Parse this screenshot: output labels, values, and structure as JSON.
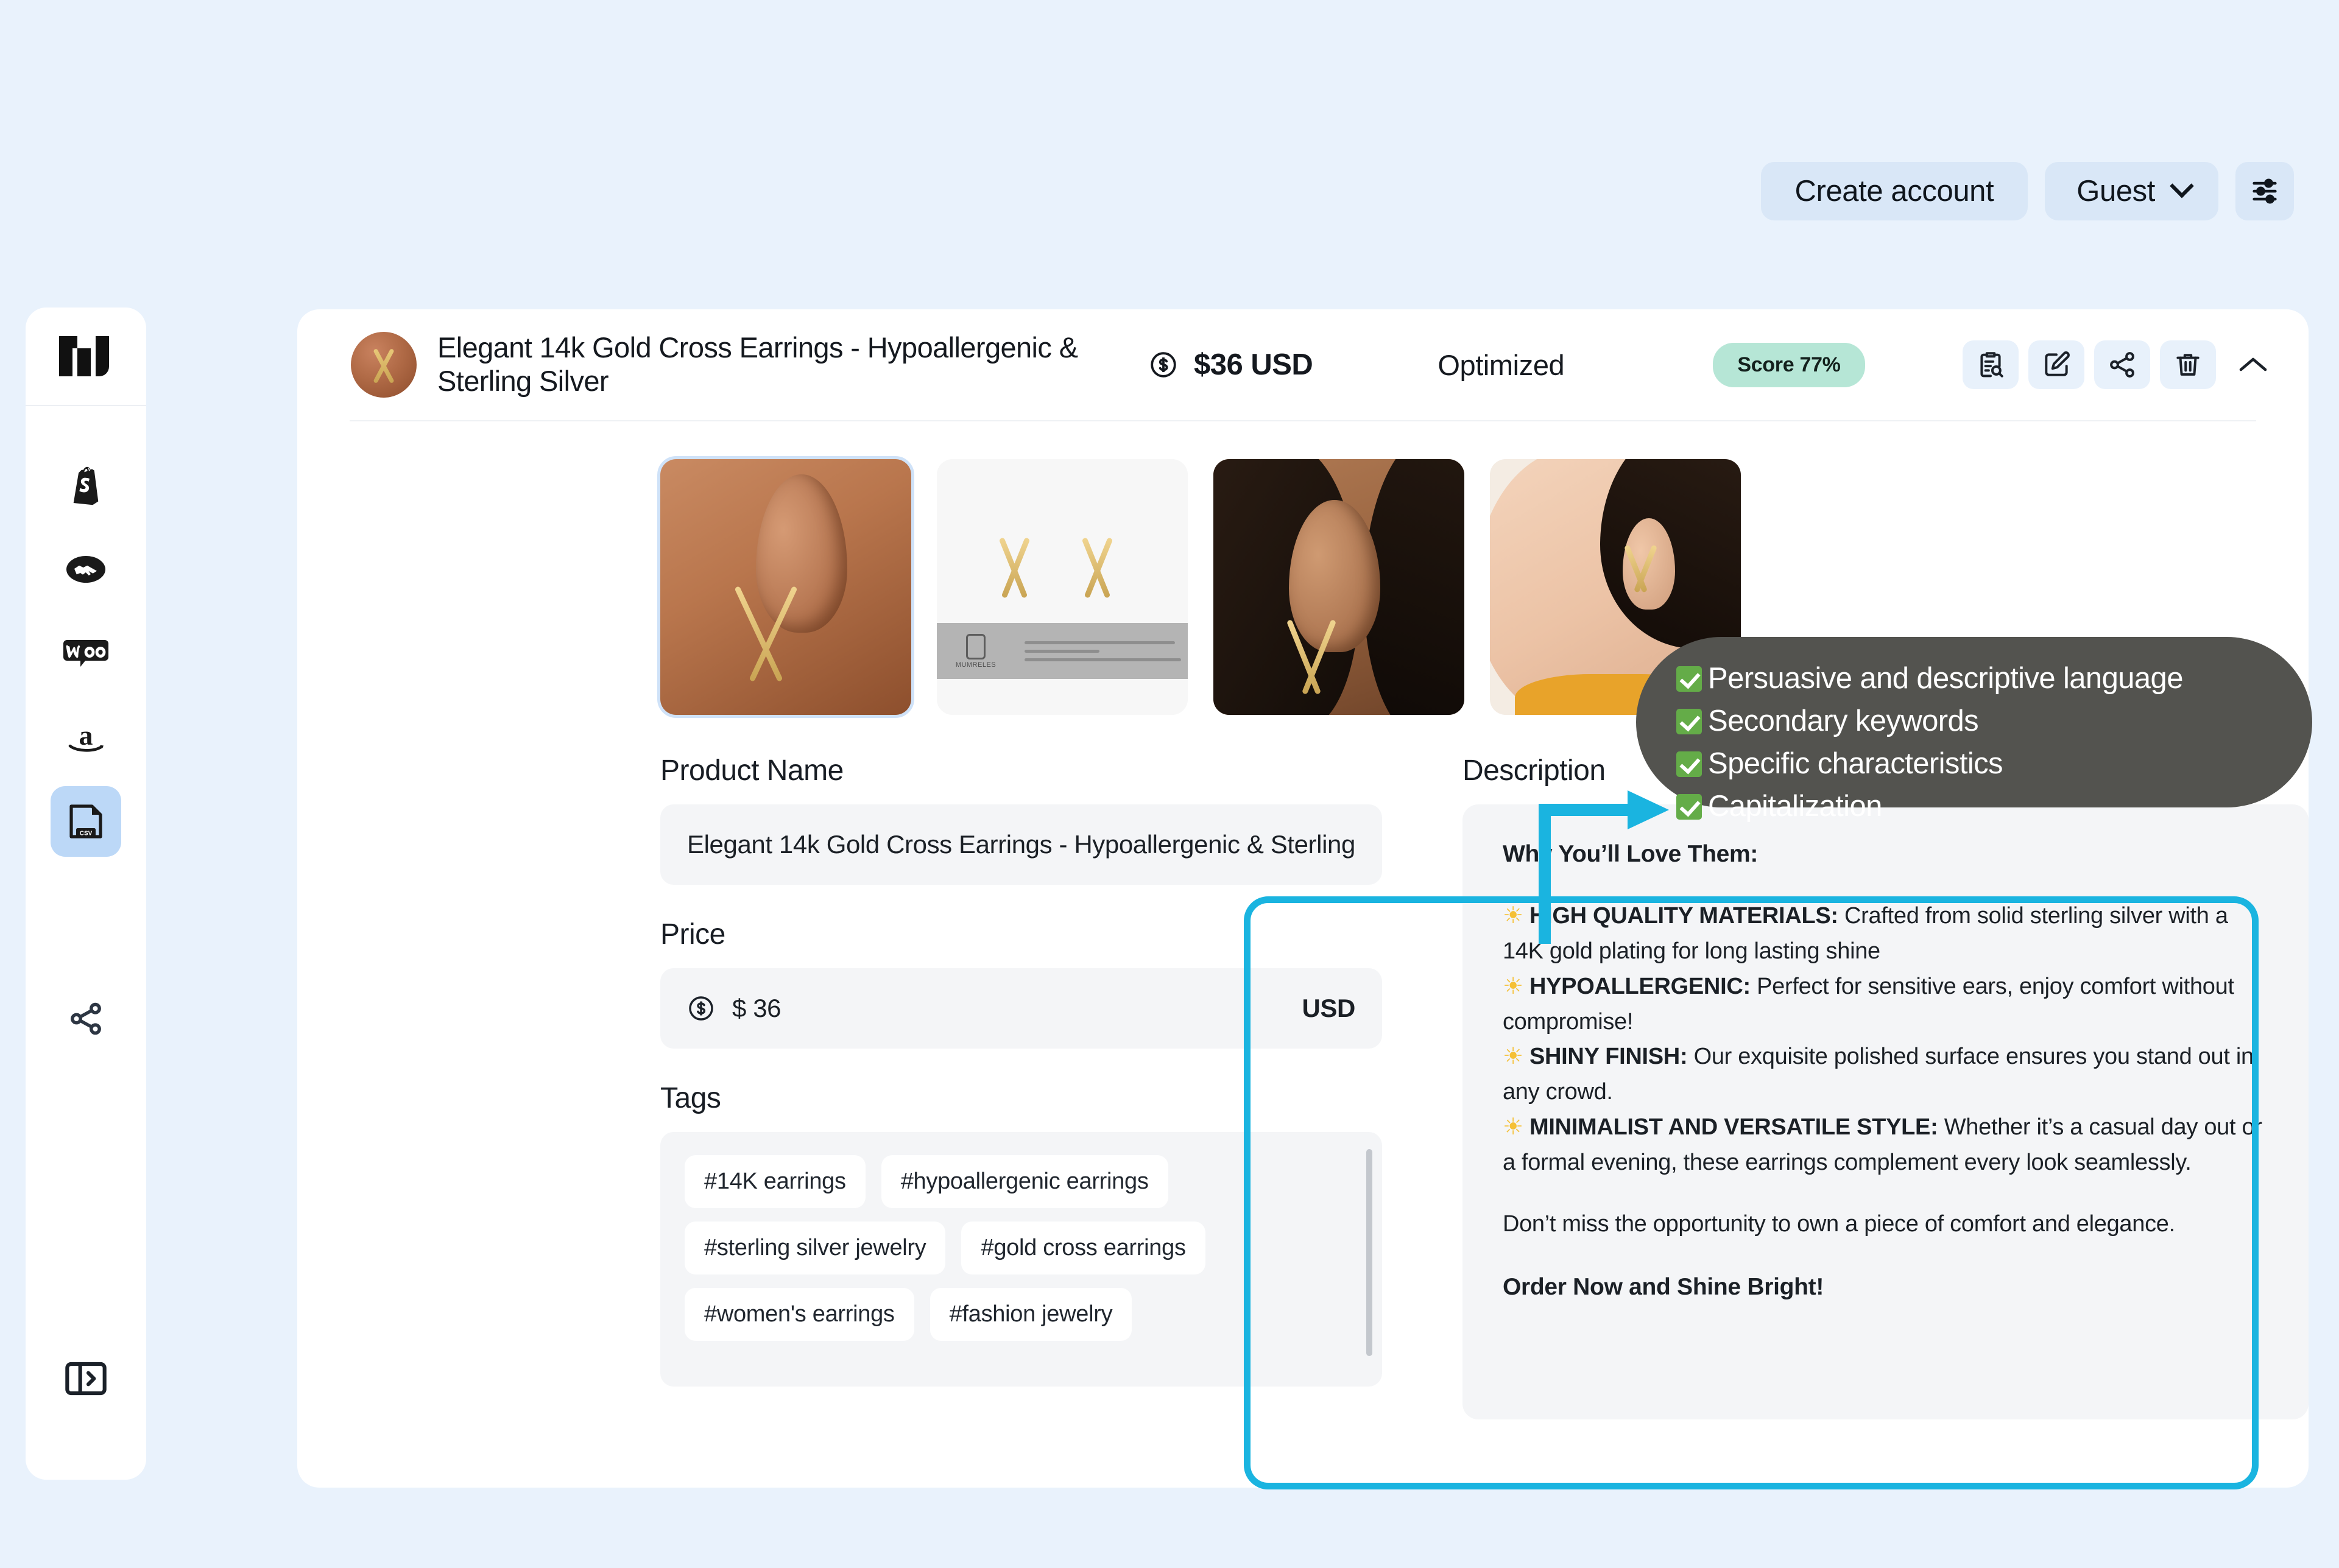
{
  "topbar": {
    "create_account_label": "Create account",
    "guest_label": "Guest",
    "settings_icon": "sliders-icon",
    "chevron_icon": "chevron-down-icon"
  },
  "sidebar": {
    "logo": "nu",
    "items": [
      {
        "name": "shopify",
        "icon": "shopify-icon",
        "active": false
      },
      {
        "name": "handshake",
        "icon": "handshake-icon",
        "active": false
      },
      {
        "name": "woocommerce",
        "icon": "woo-icon",
        "active": false
      },
      {
        "name": "amazon",
        "icon": "amazon-icon",
        "active": false
      },
      {
        "name": "csv",
        "icon": "csv-file-icon",
        "active": true
      }
    ],
    "share_icon": "share-icon",
    "collapse_icon": "panel-toggle-icon"
  },
  "card": {
    "avatar": "product-thumbnail",
    "title": "Elegant 14k Gold Cross Earrings - Hypoallergenic & Sterling Silver",
    "price_display": "$36 USD",
    "price_icon": "dollar-circle-icon",
    "status": "Optimized",
    "score_badge": "Score 77%",
    "actions": [
      {
        "name": "audit",
        "icon": "clipboard-search-icon"
      },
      {
        "name": "edit",
        "icon": "pencil-edit-icon"
      },
      {
        "name": "share",
        "icon": "share-icon"
      },
      {
        "name": "delete",
        "icon": "trash-icon"
      },
      {
        "name": "collapse",
        "icon": "chevron-up-icon"
      }
    ],
    "thumbnails": [
      {
        "name": "thumb-ear-closeup",
        "selected": true
      },
      {
        "name": "thumb-product-pair-spec",
        "selected": false
      },
      {
        "name": "thumb-model-ear-side",
        "selected": false
      },
      {
        "name": "thumb-model-portrait",
        "selected": false
      }
    ],
    "product_spec_card": {
      "brand": "MUMRELES",
      "lines": [
        "Material: High Quality Solid Sterling Silver",
        "Finish: 14k Gold",
        "Length: 18.1mm  0.72\" Thickness: 10.75mm  0.42\""
      ]
    }
  },
  "form": {
    "product_name_label": "Product Name",
    "product_name_value": "Elegant 14k Gold Cross Earrings - Hypoallergenic & Sterling",
    "price_label": "Price",
    "price_value": "$ 36",
    "price_currency": "USD",
    "tags_label": "Tags",
    "tags": [
      "#14K earrings",
      "#hypoallergenic earrings",
      "#sterling silver jewelry",
      "#gold cross earrings",
      "#women's earrings",
      "#fashion jewelry"
    ],
    "description_label": "Description",
    "description": {
      "heading": "Why You’ll Love Them:",
      "bullets": [
        {
          "title": "HIGH QUALITY MATERIALS:",
          "text": " Crafted from solid sterling silver with a 14K gold plating for long lasting shine"
        },
        {
          "title": "HYPOALLERGENIC:",
          "text": " Perfect for sensitive ears, enjoy comfort without compromise!"
        },
        {
          "title": "SHINY FINISH:",
          "text": " Our exquisite polished surface ensures you stand out in any crowd."
        },
        {
          "title": "MINIMALIST AND VERSATILE STYLE:",
          "text": " Whether it’s a casual day out or a formal evening, these earrings complement every look seamlessly."
        }
      ],
      "closing": "Don’t miss the opportunity to own a piece of comfort and elegance.",
      "cta": "Order Now and Shine Bright!"
    }
  },
  "annotation": {
    "checklist": [
      "Persuasive and descriptive language",
      "Secondary keywords",
      "Specific characteristics",
      "Capitalization"
    ],
    "highlight_color": "#1ab4e0",
    "tooltip_bg": "#53534f",
    "check_color": "#64ac48"
  },
  "colors": {
    "page_bg": "#e9f2fc",
    "card_bg": "#ffffff",
    "field_bg": "#f4f5f7",
    "accent_blue": "#bcd8f7",
    "score_green": "#b6e6d6"
  }
}
